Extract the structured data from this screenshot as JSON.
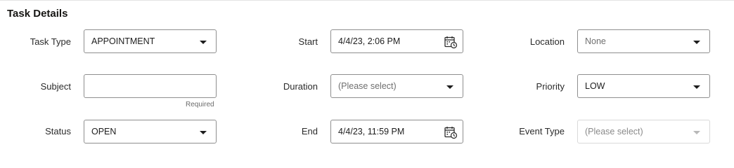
{
  "section": {
    "title": "Task Details"
  },
  "fields": {
    "task_type": {
      "label": "Task Type",
      "value": "APPOINTMENT"
    },
    "subject": {
      "label": "Subject",
      "value": "",
      "helper": "Required"
    },
    "status": {
      "label": "Status",
      "value": "OPEN"
    },
    "start": {
      "label": "Start",
      "value": "4/4/23, 2:06 PM"
    },
    "duration": {
      "label": "Duration",
      "placeholder": "(Please select)"
    },
    "end": {
      "label": "End",
      "value": "4/4/23, 11:59 PM"
    },
    "location": {
      "label": "Location",
      "placeholder": "None"
    },
    "priority": {
      "label": "Priority",
      "value": "LOW"
    },
    "event_type": {
      "label": "Event Type",
      "placeholder": "(Please select)"
    }
  },
  "icons": {
    "dropdown": "chevron-down-icon",
    "calendar": "calendar-clock-icon"
  }
}
